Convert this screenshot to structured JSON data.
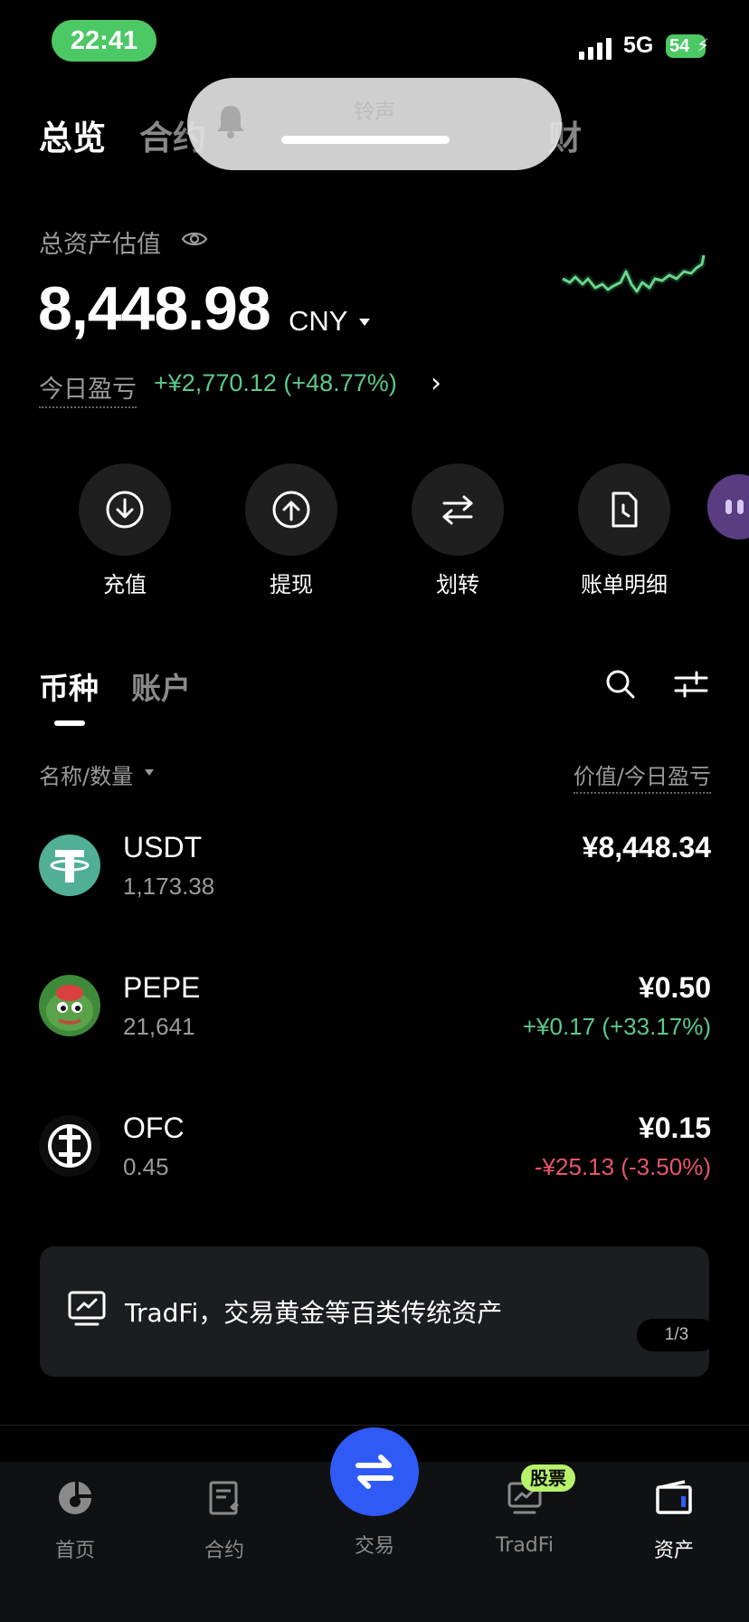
{
  "status_bar": {
    "time": "22:41",
    "network": "5G",
    "battery": "54"
  },
  "top_tabs": [
    {
      "label": "总览",
      "active": true
    },
    {
      "label": "合约",
      "active": false
    },
    {
      "label": "财",
      "active": false
    }
  ],
  "ringer_overlay": {
    "label": "铃声"
  },
  "summary": {
    "label": "总资产估值",
    "total": "8,448.98",
    "currency": "CNY",
    "pnl_label": "今日盈亏",
    "pnl_value": "+¥2,770.12 (+48.77%)"
  },
  "quick_actions": [
    {
      "label": "充值",
      "icon": "download-icon"
    },
    {
      "label": "提现",
      "icon": "upload-icon"
    },
    {
      "label": "划转",
      "icon": "transfer-icon"
    },
    {
      "label": "账单明细",
      "icon": "bill-icon"
    }
  ],
  "list_tabs": [
    {
      "label": "币种",
      "active": true
    },
    {
      "label": "账户",
      "active": false
    }
  ],
  "columns": {
    "left": "名称/数量",
    "right": "价值/今日盈亏"
  },
  "coins": [
    {
      "symbol": "USDT",
      "quantity": "1,173.38",
      "value": "¥8,448.34",
      "pnl": ""
    },
    {
      "symbol": "PEPE",
      "quantity": "21,641",
      "value": "¥0.50",
      "pnl": "+¥0.17 (+33.17%)"
    },
    {
      "symbol": "OFC",
      "quantity": "0.45",
      "value": "¥0.15",
      "pnl": "-¥25.13 (-3.50%)"
    }
  ],
  "banner": {
    "text": "TradFi，交易黄金等百类传统资产",
    "page": "1/3"
  },
  "bottom_nav": [
    {
      "label": "首页"
    },
    {
      "label": "合约"
    },
    {
      "label": "交易"
    },
    {
      "label": "TradFi",
      "badge": "股票"
    },
    {
      "label": "资产",
      "active": true
    }
  ],
  "colors": {
    "up": "#5cc98a",
    "down": "#e5566b",
    "accent": "#2f5af5",
    "badge": "#b7f26b"
  }
}
